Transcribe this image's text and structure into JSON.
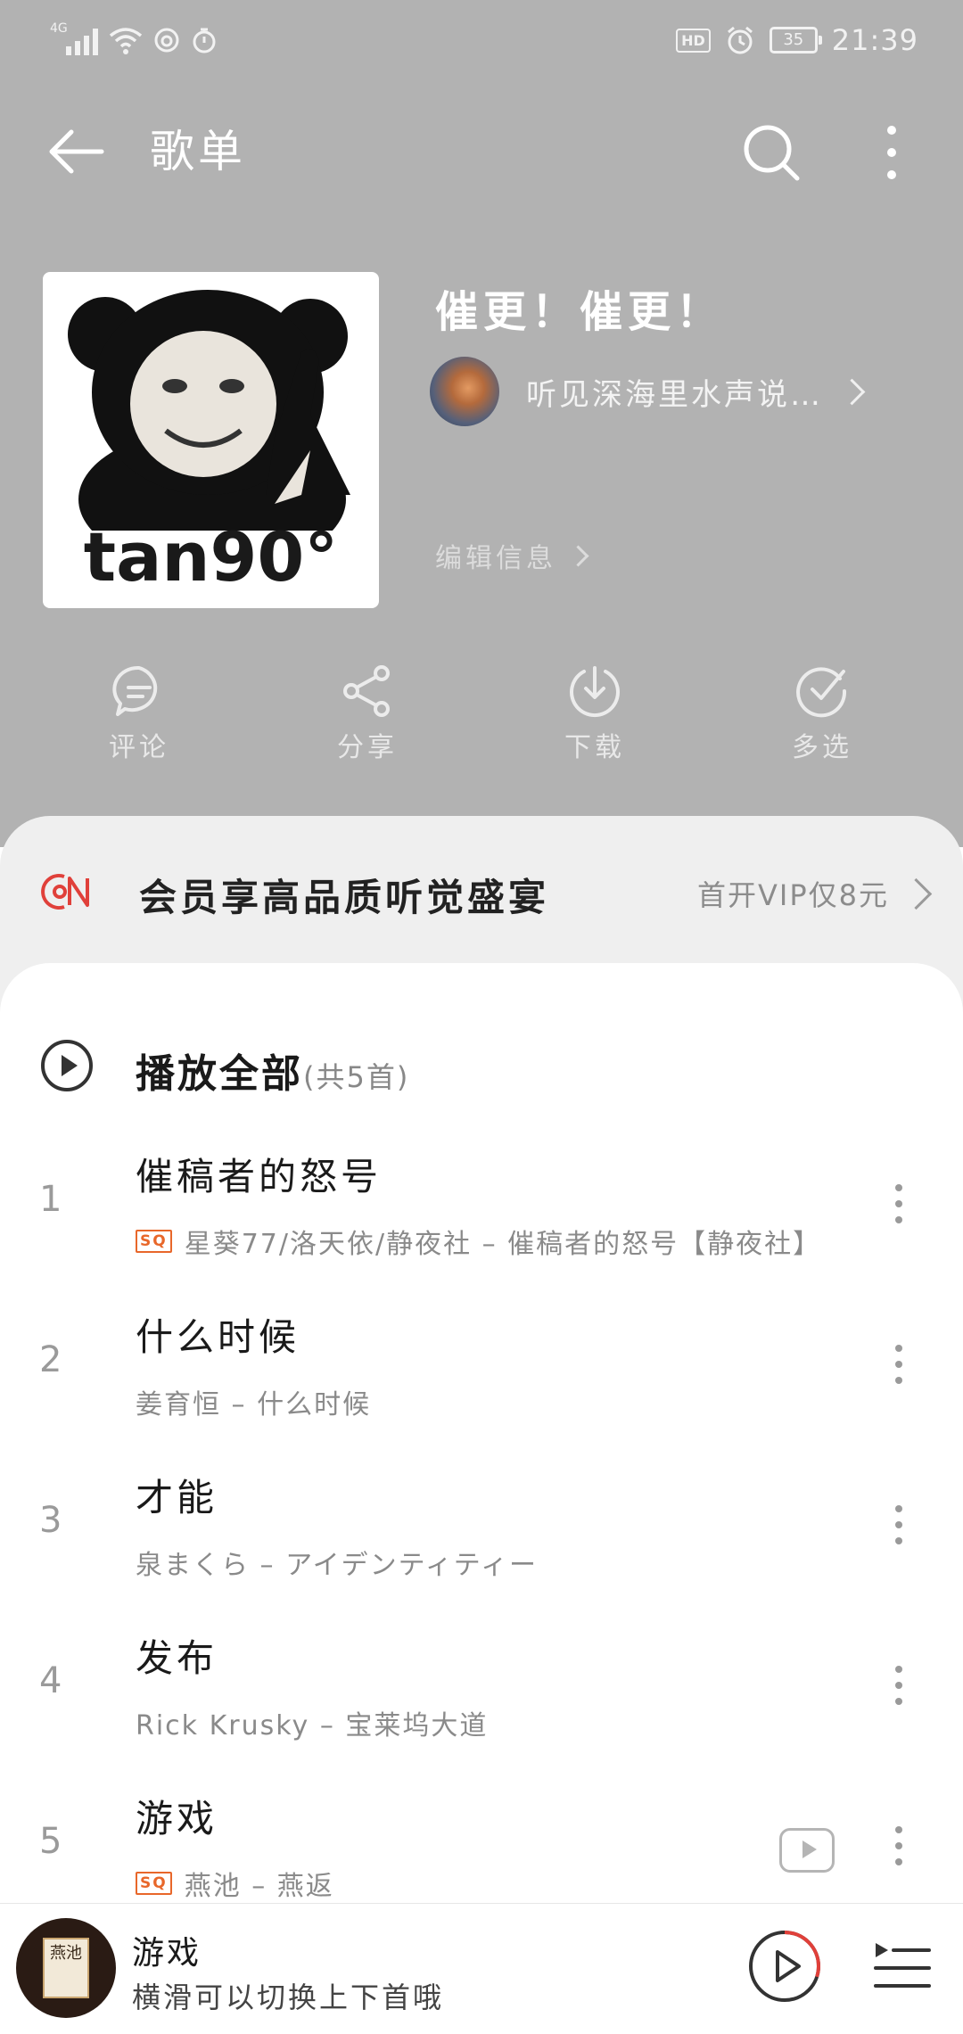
{
  "status_bar": {
    "network": "4G",
    "hd": "HD",
    "battery": "35",
    "time": "21:39"
  },
  "header": {
    "title": "歌单"
  },
  "playlist": {
    "cover_text": "tan90°",
    "title": "催更！催更！",
    "creator": "听见深海里水声说…",
    "edit_label": "编辑信息"
  },
  "actions": [
    {
      "label": "评论",
      "icon": "comment-icon"
    },
    {
      "label": "分享",
      "icon": "share-icon"
    },
    {
      "label": "下载",
      "icon": "download-icon"
    },
    {
      "label": "多选",
      "icon": "multi-select-icon"
    }
  ],
  "vip_banner": {
    "text": "会员享高品质听觉盛宴",
    "link": "首开VIP仅8元"
  },
  "play_all": {
    "label": "播放全部",
    "count": "(共5首)"
  },
  "songs": [
    {
      "num": "1",
      "title": "催稿者的怒号",
      "badge": "SQ",
      "subtitle": "星葵77/洛天依/静夜社 – 催稿者的怒号【静夜社】"
    },
    {
      "num": "2",
      "title": "什么时候",
      "badge": "",
      "subtitle": "姜育恒 – 什么时候"
    },
    {
      "num": "3",
      "title": "才能",
      "badge": "",
      "subtitle": "泉まくら – アイデンティティー"
    },
    {
      "num": "4",
      "title": "发布",
      "badge": "",
      "subtitle": "Rick Krusky – 宝莱坞大道"
    },
    {
      "num": "5",
      "title": "游戏",
      "badge": "SQ",
      "subtitle": "燕池 – 燕返"
    }
  ],
  "player": {
    "title": "游戏",
    "subtitle": "横滑可以切换上下首哦",
    "disc_text": "燕池",
    "progress": 0.3
  },
  "colors": {
    "header_bg": "#b2b2b2",
    "accent_red": "#e0403a",
    "sq_orange": "#e8672a"
  }
}
